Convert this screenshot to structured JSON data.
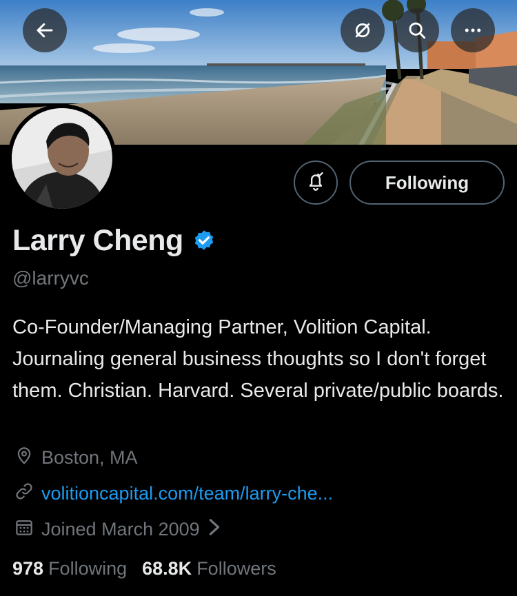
{
  "profile": {
    "name": "Larry Cheng",
    "handle": "@larryvc",
    "bio": "Co-Founder/Managing Partner, Volition Capital. Journaling general business thoughts so I don't forget them. Christian. Harvard. Several private/public boards.",
    "location": "Boston, MA",
    "website": "volitioncapital.com/team/larry-che...",
    "joined": "Joined March 2009",
    "verified": true
  },
  "actions": {
    "follow_label": "Following"
  },
  "stats": {
    "following_count": "978",
    "following_label": "Following",
    "followers_count": "68.8K",
    "followers_label": "Followers"
  },
  "icons": {
    "back": "arrow-left-icon",
    "no_filter": "no-filter-icon",
    "search": "search-icon",
    "more": "more-icon",
    "notify": "bell-check-icon",
    "verified": "verified-badge-icon",
    "location": "location-pin-icon",
    "link": "link-icon",
    "calendar": "calendar-icon"
  },
  "colors": {
    "background": "#000000",
    "accent": "#1d9bf0",
    "verified": "#1d9bf0",
    "secondary_text": "#71767b",
    "border": "#536471"
  }
}
